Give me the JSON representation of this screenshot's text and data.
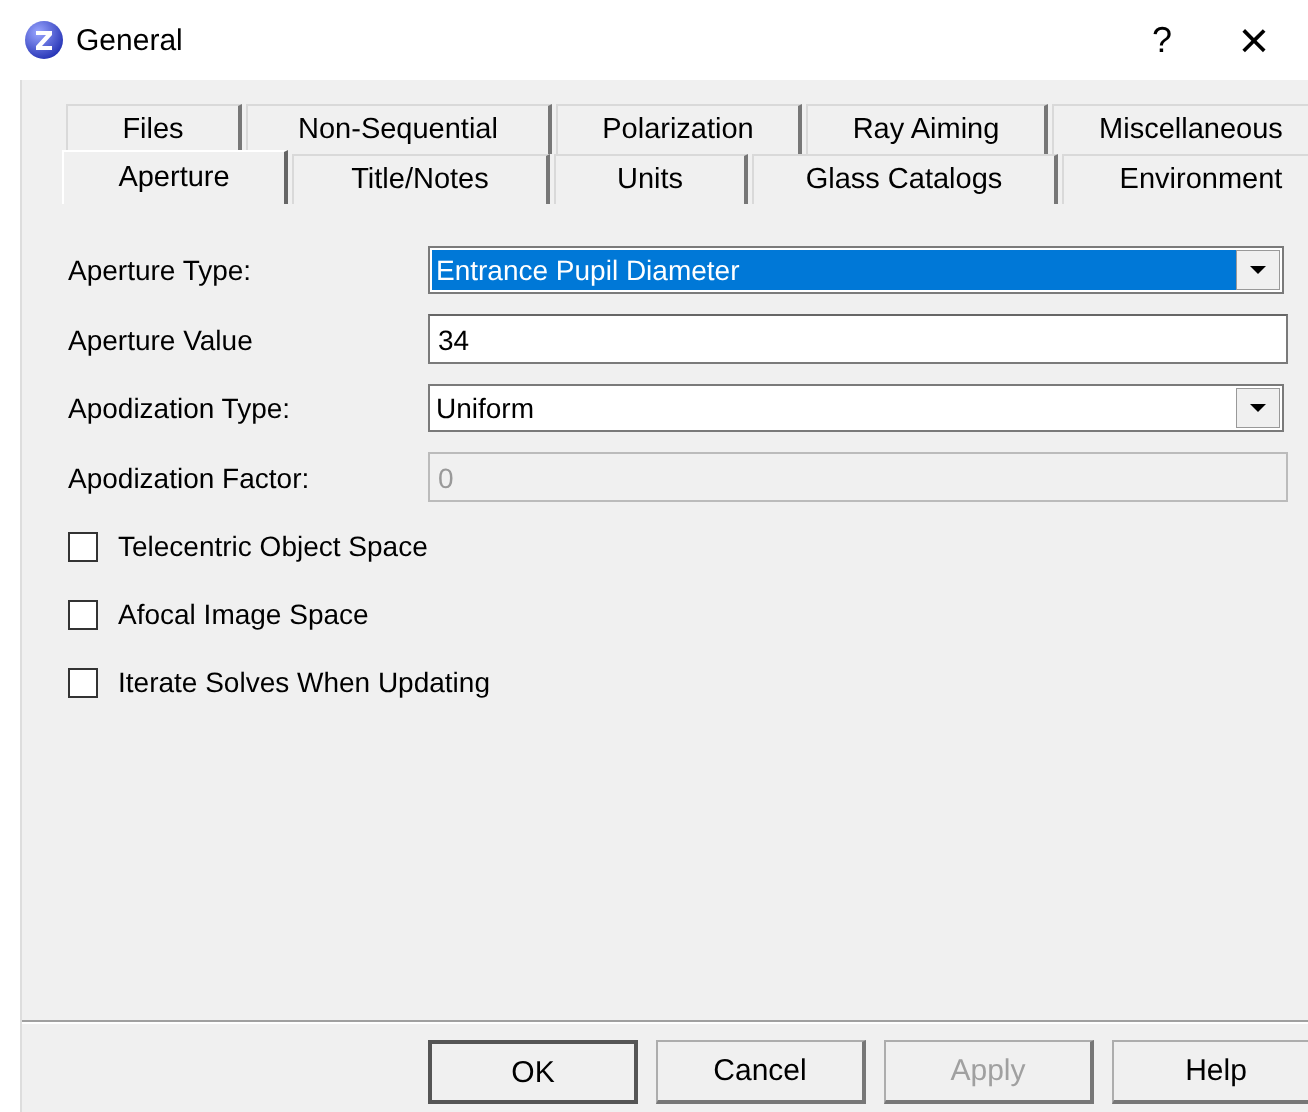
{
  "window": {
    "title": "General",
    "help": "?",
    "close": "×"
  },
  "tab_rows": [
    [
      {
        "label": "Files",
        "selected": false
      },
      {
        "label": "Non-Sequential",
        "selected": false
      },
      {
        "label": "Polarization",
        "selected": false
      },
      {
        "label": "Ray Aiming",
        "selected": false
      },
      {
        "label": "Miscellaneous",
        "selected": false
      }
    ],
    [
      {
        "label": "Aperture",
        "selected": true
      },
      {
        "label": "Title/Notes",
        "selected": false
      },
      {
        "label": "Units",
        "selected": false
      },
      {
        "label": "Glass Catalogs",
        "selected": false
      },
      {
        "label": "Environment",
        "selected": false
      }
    ]
  ],
  "fields": [
    {
      "kind": "dropdown",
      "label": "Aperture Type:",
      "value": "Entrance Pupil Diameter",
      "focused": true
    },
    {
      "kind": "text",
      "label": "Aperture Value",
      "value": "34",
      "disabled": false
    },
    {
      "kind": "dropdown",
      "label": "Apodization Type:",
      "value": "Uniform",
      "focused": false
    },
    {
      "kind": "text",
      "label": "Apodization Factor:",
      "value": "0",
      "disabled": true
    }
  ],
  "checkboxes": [
    {
      "label": "Telecentric Object Space",
      "checked": false
    },
    {
      "label": "Afocal Image Space",
      "checked": false
    },
    {
      "label": "Iterate Solves When Updating",
      "checked": false
    }
  ],
  "buttons": [
    {
      "label": "OK",
      "default": true,
      "disabled": false
    },
    {
      "label": "Cancel",
      "default": false,
      "disabled": false
    },
    {
      "label": "Apply",
      "default": false,
      "disabled": true
    },
    {
      "label": "Help",
      "default": false,
      "disabled": false
    }
  ]
}
